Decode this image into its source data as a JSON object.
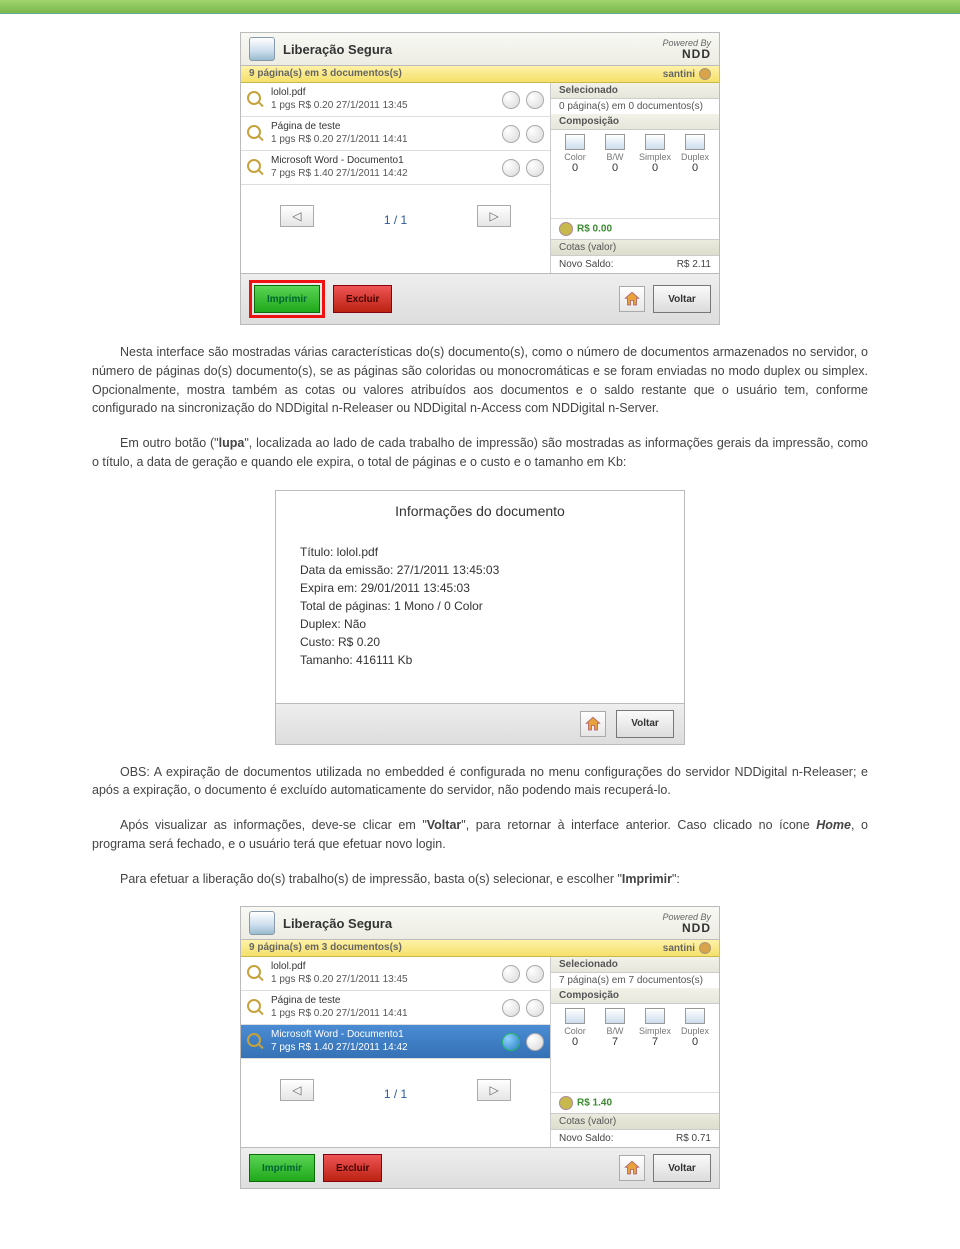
{
  "screenshot1": {
    "title": "Liberação Segura",
    "brand_line1": "Powered By",
    "brand_line2": "NDD",
    "statusbar": "9 página(s) em 3 documentos(s)",
    "user": "santini",
    "docs": [
      {
        "name": "lolol.pdf",
        "line": "1 pgs  R$ 0.20  27/1/2011 13:45"
      },
      {
        "name": "Página de teste",
        "line": "1 pgs  R$ 0.20  27/1/2011 14:41"
      },
      {
        "name": "Microsoft Word - Documento1",
        "line": "7 pgs  R$ 1.40  27/1/2011 14:42"
      }
    ],
    "side": {
      "selecionado_label": "Selecionado",
      "selecionado_value": "0 página(s) em 0 documentos(s)",
      "composicao_label": "Composição",
      "labels": [
        "Color",
        "B/W",
        "Simplex",
        "Duplex"
      ],
      "values": [
        "0",
        "0",
        "0",
        "0"
      ],
      "cash": "R$ 0.00",
      "cotas_label": "Cotas (valor)",
      "saldo_label": "Novo Saldo:",
      "saldo_value": "R$ 2.11"
    },
    "pager": "1 / 1",
    "buttons": {
      "imprimir": "Imprimir",
      "excluir": "Excluir",
      "voltar": "Voltar"
    }
  },
  "para1": "Nesta interface são mostradas várias características do(s) documento(s), como o número de documentos armazenados no servidor, o número de páginas do(s) documento(s), se as páginas são coloridas ou monocromáticas e se foram enviadas no modo duplex ou simplex. Opcionalmente, mostra também as cotas ou valores atribuídos aos documentos e o saldo restante que o usuário tem, conforme configurado na sincronização do NDDigital n-Releaser ou NDDigital n-Access com NDDigital n-Server.",
  "para2_pre": "Em outro botão (\"",
  "para2_lupa": "lupa",
  "para2_post": "\", localizada ao lado de cada trabalho de impressão) são mostradas as informações gerais da impressão, como o título, a data de geração e quando ele expira, o total de páginas e o custo e o tamanho em Kb:",
  "dialog": {
    "title": "Informações do documento",
    "lines": {
      "l1": "Título: lolol.pdf",
      "l2": "Data da emissão: 27/1/2011 13:45:03",
      "l3": "Expira em: 29/01/2011 13:45:03",
      "l4": "Total de páginas: 1 Mono / 0 Color",
      "l5": "Duplex: Não",
      "l6": "Custo: R$  0.20",
      "l7": "Tamanho: 416111 Kb"
    },
    "voltar": "Voltar"
  },
  "para3": "OBS: A expiração de documentos utilizada no embedded é configurada no menu configurações do servidor NDDigital n-Releaser; e após a expiração, o documento é excluído automaticamente do servidor, não podendo mais recuperá-lo.",
  "para4_a": "Após visualizar as informações, deve-se clicar em \"",
  "para4_voltar": "Voltar",
  "para4_b": "\", para retornar à interface anterior. Caso clicado no ícone ",
  "para4_home": "Home",
  "para4_c": ", o programa será fechado, e o usuário terá que efetuar novo login.",
  "para5_a": "Para efetuar a liberação do(s) trabalho(s) de impressão, basta o(s) selecionar, e escolher \"",
  "para5_imprimir": "Imprimir",
  "para5_b": "\":",
  "screenshot2": {
    "title": "Liberação Segura",
    "brand_line1": "Powered By",
    "brand_line2": "NDD",
    "statusbar": "9 página(s) em 3 documentos(s)",
    "user": "santini",
    "docs": [
      {
        "name": "lolol.pdf",
        "line": "1 pgs  R$ 0.20  27/1/2011 13:45"
      },
      {
        "name": "Página de teste",
        "line": "1 pgs  R$ 0.20  27/1/2011 14:41"
      },
      {
        "name": "Microsoft Word - Documento1",
        "line": "7 pgs  R$ 1.40  27/1/2011 14:42"
      }
    ],
    "side": {
      "selecionado_label": "Selecionado",
      "selecionado_value": "7 página(s) em 7 documentos(s)",
      "composicao_label": "Composição",
      "labels": [
        "Color",
        "B/W",
        "Simplex",
        "Duplex"
      ],
      "values": [
        "0",
        "7",
        "7",
        "0"
      ],
      "cash": "R$ 1.40",
      "cotas_label": "Cotas (valor)",
      "saldo_label": "Novo Saldo:",
      "saldo_value": "R$ 0.71"
    },
    "pager": "1 / 1",
    "buttons": {
      "imprimir": "Imprimir",
      "excluir": "Excluir",
      "voltar": "Voltar"
    }
  }
}
